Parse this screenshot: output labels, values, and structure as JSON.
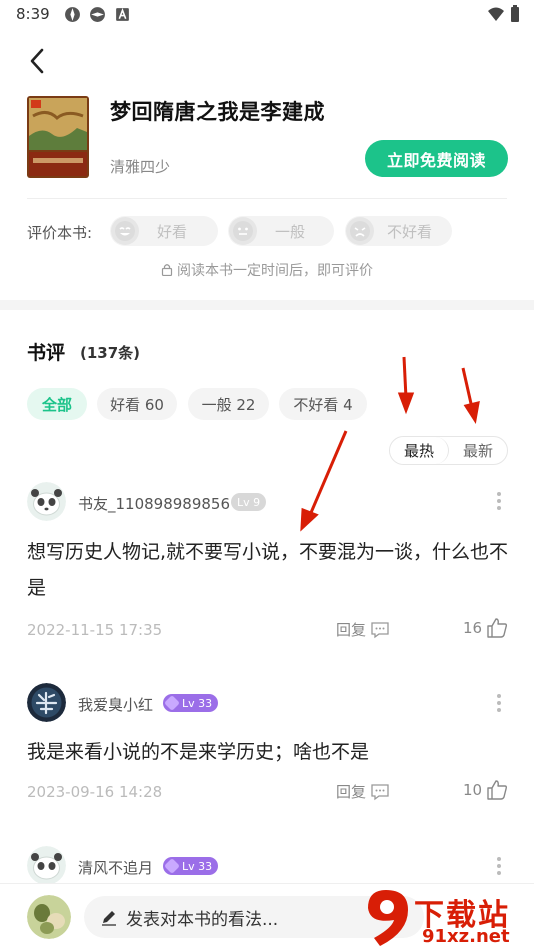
{
  "status_bar": {
    "time": "8:39"
  },
  "book": {
    "title": "梦回隋唐之我是李建成",
    "author": "清雅四少",
    "read_button": "立即免费阅读"
  },
  "rating": {
    "label": "评价本书:",
    "options": [
      "好看",
      "一般",
      "不好看"
    ],
    "hint": "阅读本书一定时间后，即可评价"
  },
  "reviews": {
    "title": "书评",
    "count": "(137条)",
    "filters": [
      "全部",
      "好看 60",
      "一般 22",
      "不好看 4"
    ],
    "sort": [
      "最热",
      "最新"
    ],
    "items": [
      {
        "user": "书友_110898989856",
        "level": "Lv 9",
        "text": "想写历史人物记,就不要写小说，不要混为一谈，什么也不是",
        "date": "2022-11-15 17:35",
        "reply": "回复",
        "likes": "16"
      },
      {
        "user": "我爱臭小红",
        "level": "Lv 33",
        "text": "我是来看小说的不是来学历史；啥也不是",
        "date": "2023-09-16 14:28",
        "reply": "回复",
        "likes": "10"
      },
      {
        "user": "清风不追月",
        "level": "Lv 33"
      }
    ]
  },
  "bottom": {
    "placeholder": "发表对本书的看法..."
  },
  "watermark": {
    "top": "下载站",
    "bottom": "91xz.net"
  },
  "colors": {
    "accent": "#1cc38a",
    "arrow": "#d81e06",
    "purple_badge": "#9b6ee8"
  }
}
